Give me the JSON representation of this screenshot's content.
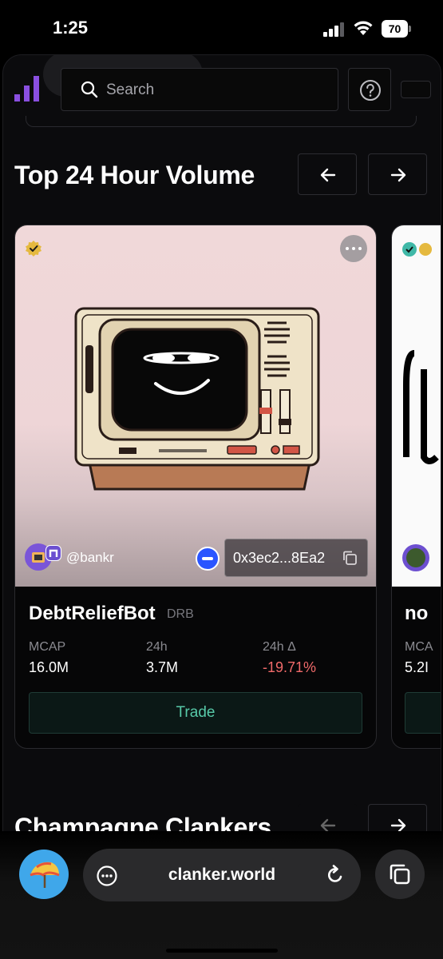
{
  "status_bar": {
    "time": "1:25",
    "battery": "70"
  },
  "header": {
    "search": {
      "placeholder": "Search"
    }
  },
  "sections": {
    "top_volume": {
      "title": "Top 24 Hour Volume"
    },
    "champagne": {
      "title": "Champagne Clankers"
    }
  },
  "token_card": {
    "creator": "@bankr",
    "address": "0x3ec2...8Ea2",
    "name": "DebtReliefBot",
    "ticker": "DRB",
    "stats": [
      {
        "label": "MCAP",
        "value": "16.0M"
      },
      {
        "label": "24h",
        "value": "3.7M"
      },
      {
        "label": "24h Δ",
        "value": "-19.71%"
      }
    ],
    "trade_label": "Trade",
    "negative_color": "#f06a6a",
    "accent_color": "#57c9a8"
  },
  "next_card": {
    "name_partial": "no",
    "stat_label_partial": "MCA",
    "stat_value_partial": "5.2I"
  },
  "browser": {
    "url": "clanker.world"
  }
}
